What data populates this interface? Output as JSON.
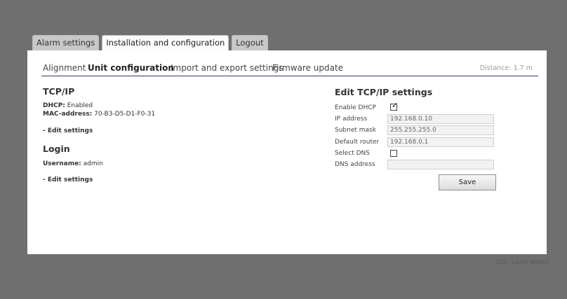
{
  "tabs": [
    "Alarm settings",
    "Installation and configuration",
    "Logout"
  ],
  "subnav": {
    "items": [
      "Alignment",
      "Unit configuration",
      "Import and export settings",
      "Firmware update"
    ],
    "distance": "Distance: 1.7 m"
  },
  "tcpip": {
    "title": "TCP/IP",
    "dhcp_label": "DHCP:",
    "dhcp_value": "Enabled",
    "mac_label": "MAC-address:",
    "mac_value": "70-B3-D5-D1-F0-31",
    "edit_link": "- Edit settings"
  },
  "login": {
    "title": "Login",
    "username_label": "Username:",
    "username_value": "admin",
    "edit_link": "- Edit settings"
  },
  "edit_form": {
    "title": "Edit TCP/IP settings",
    "enable_dhcp_label": "Enable DHCP",
    "enable_dhcp_checked": true,
    "ip_label": "IP address",
    "ip_value": "192.168.0.10",
    "subnet_label": "Subnet mask",
    "subnet_value": "255.255.255.0",
    "router_label": "Default router",
    "router_value": "192.168.0.1",
    "select_dns_label": "Select DNS",
    "select_dns_checked": false,
    "dns_label": "DNS address",
    "dns_value": "",
    "save_label": "Save"
  },
  "footer": "GJD - Laser Watch"
}
